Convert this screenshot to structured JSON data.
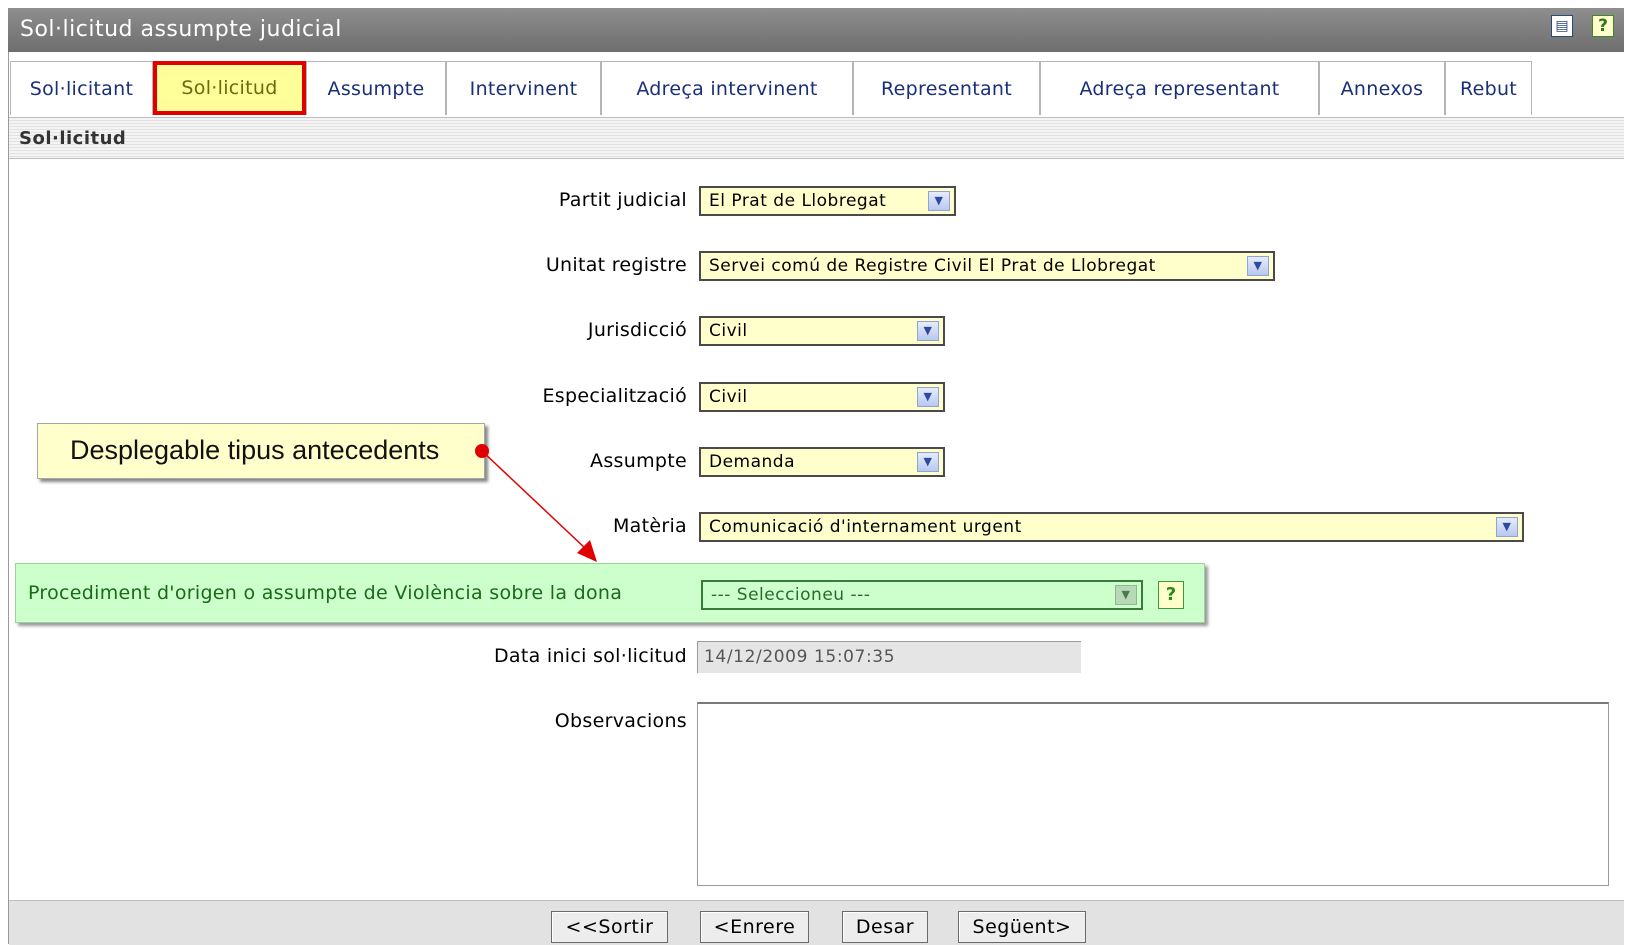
{
  "window": {
    "title": "Sol·licitud assumpte judicial",
    "icons": [
      "document-icon",
      "help-icon"
    ]
  },
  "tabs": [
    {
      "label": "Sol·licitant"
    },
    {
      "label": "Sol·licitud",
      "active": true
    },
    {
      "label": "Assumpte"
    },
    {
      "label": "Intervinent"
    },
    {
      "label": "Adreça intervinent"
    },
    {
      "label": "Representant"
    },
    {
      "label": "Adreça representant"
    },
    {
      "label": "Annexos"
    },
    {
      "label": "Rebut"
    }
  ],
  "section_title": "Sol·licitud",
  "form": {
    "partit_judicial": {
      "label": "Partit judicial",
      "value": "El Prat de Llobregat"
    },
    "unitat_registre": {
      "label": "Unitat registre",
      "value": "Servei comú de Registre Civil El Prat de Llobregat"
    },
    "jurisdiccio": {
      "label": "Jurisdicció",
      "value": "Civil"
    },
    "especialitzacio": {
      "label": "Especialització",
      "value": "Civil"
    },
    "assumpte": {
      "label": "Assumpte",
      "value": "Demanda"
    },
    "materia": {
      "label": "Matèria",
      "value": "Comunicació d'internament urgent"
    },
    "procediment": {
      "label": "Procediment d'origen o assumpte de Violència sobre la dona",
      "value": "--- Seleccioneu ---"
    },
    "data_inici": {
      "label": "Data inici sol·licitud",
      "value": "14/12/2009 15:07:35"
    },
    "observacions": {
      "label": "Observacions",
      "value": ""
    }
  },
  "callout": {
    "text": "Desplegable tipus antecedents"
  },
  "buttons": {
    "sortir": "<<Sortir",
    "enrere": "<Enrere",
    "desar": "Desar",
    "seguent": "Següent>"
  },
  "colors": {
    "title_bar": "#7f7f7f",
    "field_bg": "#ffffcc",
    "highlight_bg": "#ccffcc",
    "active_tab_border": "#e00000",
    "tab_text": "#1a2f7a"
  }
}
